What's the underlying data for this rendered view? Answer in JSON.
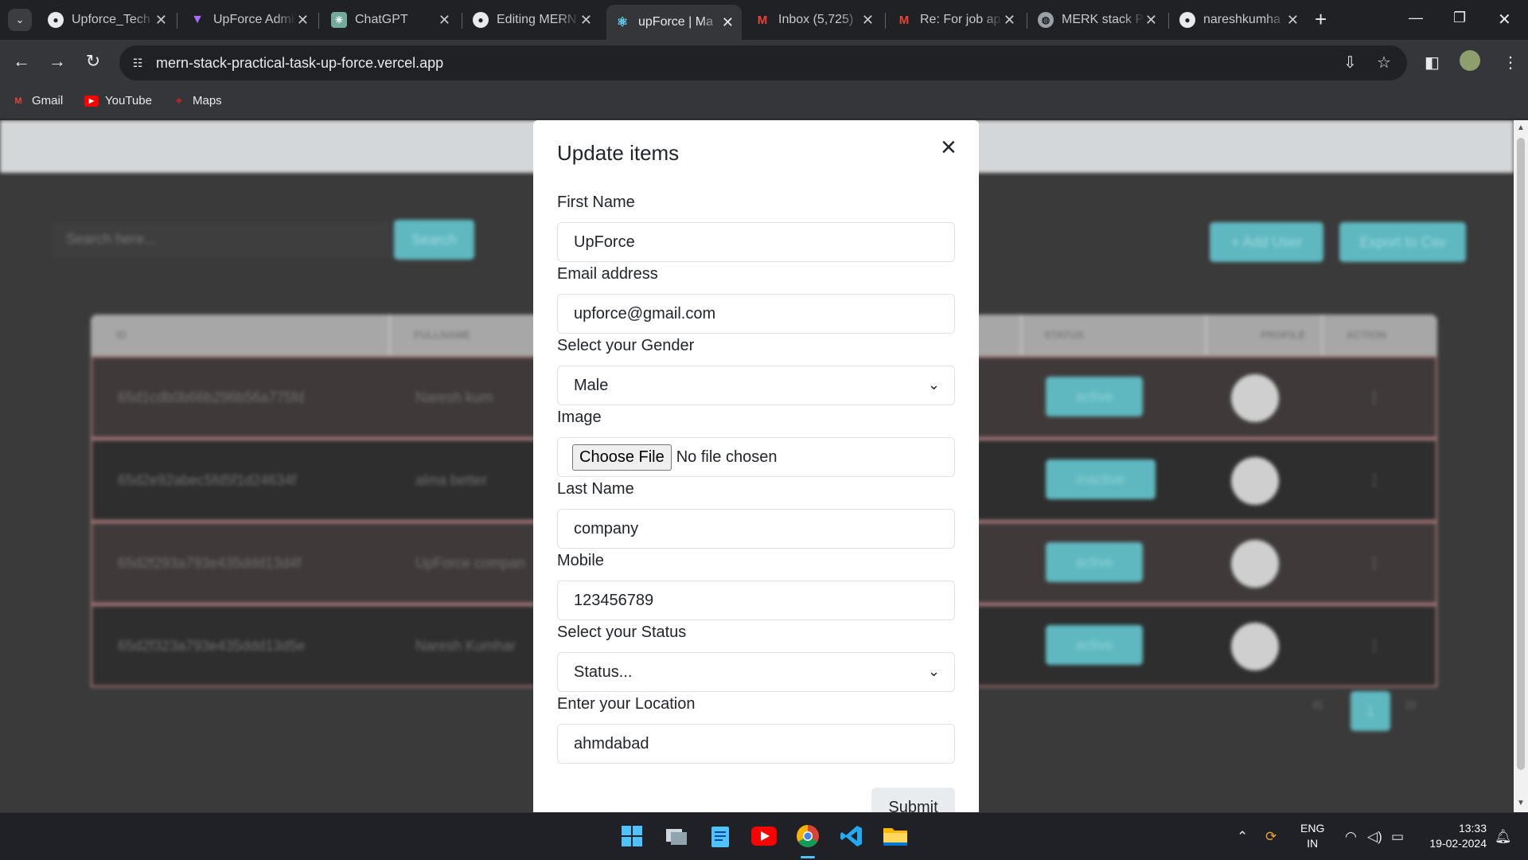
{
  "browser": {
    "tabs": [
      {
        "label": "Upforce_Tech",
        "icon": "github-icon"
      },
      {
        "label": "UpForce Admin",
        "icon": "vite-icon"
      },
      {
        "label": "ChatGPT",
        "icon": "chatgpt-icon"
      },
      {
        "label": "Editing MERN",
        "icon": "github-icon"
      },
      {
        "label": "upForce | Ma",
        "icon": "react-icon",
        "active": true
      },
      {
        "label": "Inbox (5,725)",
        "icon": "gmail-icon"
      },
      {
        "label": "Re: For job ap",
        "icon": "gmail-icon"
      },
      {
        "label": "MERK stack P",
        "icon": "globe-icon"
      },
      {
        "label": "nareshkumha",
        "icon": "github-icon"
      }
    ],
    "url": "mern-stack-practical-task-up-force.vercel.app",
    "bookmarks": [
      {
        "label": "Gmail"
      },
      {
        "label": "YouTube"
      },
      {
        "label": "Maps"
      }
    ]
  },
  "page": {
    "search_placeholder": "Search here...",
    "search_button": "Search",
    "add_user_button": "+ Add User",
    "export_button": "Export to Csv",
    "table": {
      "headers": [
        "ID",
        "FULLNAME",
        "STATUS",
        "PROFILE",
        "ACTION"
      ],
      "rows": [
        {
          "id": "65d1cdb0b66b296b56a775fd",
          "fullname": "Naresh kum",
          "status": "active"
        },
        {
          "id": "65d2e92abec5fd5f1d24634f",
          "fullname": "alma better",
          "status": "inactive"
        },
        {
          "id": "65d2f293a793e435ddd13d4f",
          "fullname": "UpForce compan",
          "status": "active"
        },
        {
          "id": "65d2f323a793e435ddd13d5e",
          "fullname": "Naresh Kumhar",
          "status": "active"
        }
      ]
    },
    "pagination": {
      "current": "1",
      "prev": "«",
      "next": "»"
    }
  },
  "modal": {
    "title": "Update items",
    "close_icon": "×",
    "fields": {
      "first_name": {
        "label": "First Name",
        "value": "UpForce"
      },
      "email": {
        "label": "Email address",
        "value": "upforce@gmail.com"
      },
      "gender": {
        "label": "Select your Gender",
        "value": "Male"
      },
      "image": {
        "label": "Image",
        "button": "Choose File",
        "status": "No file chosen"
      },
      "last_name": {
        "label": "Last Name",
        "value": "company"
      },
      "mobile": {
        "label": "Mobile",
        "value": "123456789"
      },
      "status": {
        "label": "Select your Status",
        "value": "Status..."
      },
      "location": {
        "label": "Enter your Location",
        "value": "ahmdabad"
      }
    },
    "submit": "Submit"
  },
  "taskbar": {
    "lang_top": "ENG",
    "lang_bottom": "IN",
    "time": "13:33",
    "date": "19-02-2024"
  }
}
